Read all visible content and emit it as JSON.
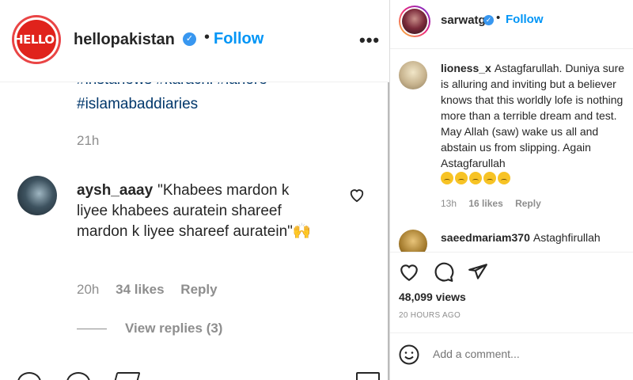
{
  "left_post": {
    "username": "hellopakistan",
    "logo_text": "HELLO!",
    "follow_label": "Follow",
    "more_label": "•••",
    "hashtags_cut": "#instanews #karachi #lahore",
    "hashtag": "#islamabaddiaries",
    "post_time": "21h",
    "comment": {
      "username": "aysh_aaay",
      "text": "\"Khabees mardon k liyee khabees auratein shareef mardon k liyee shareef auratein\"🙌",
      "time": "20h",
      "likes": "34 likes",
      "reply_label": "Reply",
      "view_replies": "View replies (3)"
    }
  },
  "right_post": {
    "username": "sarwatg",
    "follow_label": "Follow",
    "comment1": {
      "username": "lioness_x",
      "text": "Astagfarullah. Duniya sure is alluring and inviting but a believer knows that this worldly lofe is nothing more than a terrible dream and test. May Allah (saw) wake us all and abstain us from slipping. Again Astagfarullah",
      "emoji_count": 5,
      "time": "13h",
      "likes": "16 likes",
      "reply_label": "Reply"
    },
    "comment2": {
      "username": "saeedmariam370",
      "text": "Astaghfirullah"
    },
    "views": "48,099 views",
    "date": "20 HOURS AGO",
    "add_comment_placeholder": "Add a comment..."
  },
  "colors": {
    "accent": "#0095f6",
    "verified": "#3897f0",
    "hashtag": "#00376b",
    "muted": "#8e8e8e",
    "text": "#262626"
  }
}
